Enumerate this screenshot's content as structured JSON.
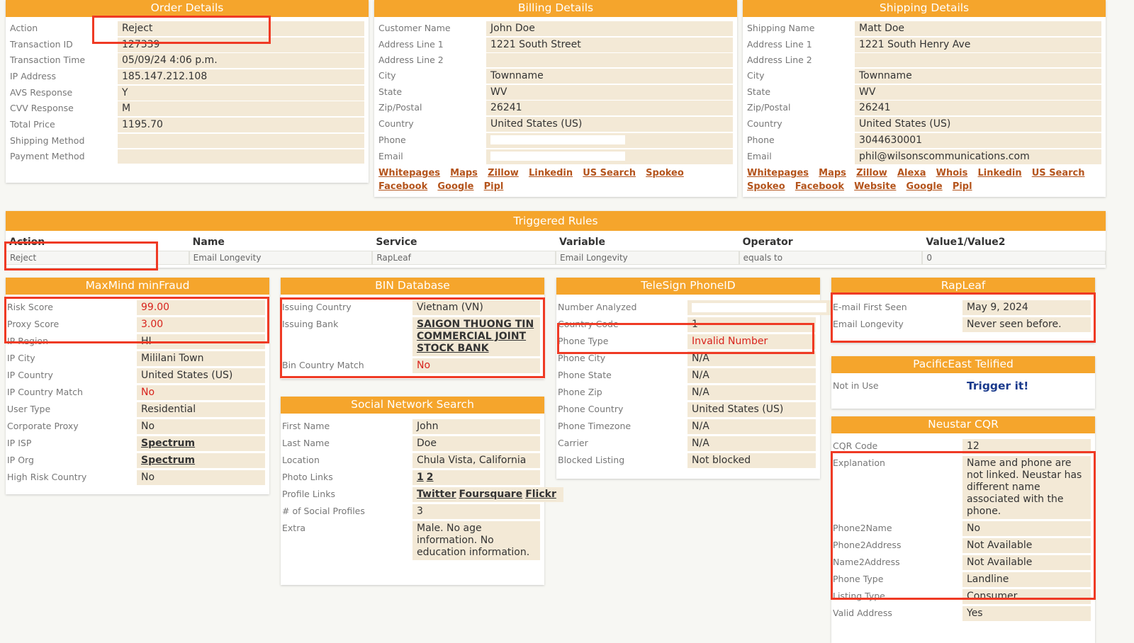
{
  "colors": {
    "header": "#f5a52c",
    "value_bg": "#f3e9d6",
    "alert": "#d8231c",
    "link": "#b4541c",
    "highlight": "#ef3a24"
  },
  "panels": {
    "order": {
      "title": "Order Details",
      "rows": [
        {
          "label": "Action",
          "value": "Reject"
        },
        {
          "label": "Transaction ID",
          "value": "127339"
        },
        {
          "label": "Transaction Time",
          "value": "05/09/24 4:06 p.m."
        },
        {
          "label": "IP Address",
          "value": "185.147.212.108"
        },
        {
          "label": "AVS Response",
          "value": "Y"
        },
        {
          "label": "CVV Response",
          "value": "M"
        },
        {
          "label": "Total Price",
          "value": "1195.70"
        },
        {
          "label": "Shipping Method",
          "value": ""
        },
        {
          "label": "Payment Method",
          "value": ""
        }
      ]
    },
    "billing": {
      "title": "Billing Details",
      "rows": [
        {
          "label": "Customer Name",
          "value": "John Doe"
        },
        {
          "label": "Address Line 1",
          "value": "1221 South Street"
        },
        {
          "label": "Address Line 2",
          "value": ""
        },
        {
          "label": "City",
          "value": "Townname"
        },
        {
          "label": "State",
          "value": "WV"
        },
        {
          "label": "Zip/Postal",
          "value": "26241"
        },
        {
          "label": "Country",
          "value": "United States (US)"
        },
        {
          "label": "Phone",
          "value": "",
          "style": "redacted"
        },
        {
          "label": "Email",
          "value": "",
          "style": "redacted"
        }
      ],
      "links": [
        "Whitepages",
        "Maps",
        "Zillow",
        "Linkedin",
        "US Search",
        "Spokeo",
        "Facebook",
        "Google",
        "Pipl"
      ]
    },
    "shipping": {
      "title": "Shipping Details",
      "rows": [
        {
          "label": "Shipping Name",
          "value": "Matt Doe"
        },
        {
          "label": "Address Line 1",
          "value": "1221 South Henry Ave"
        },
        {
          "label": "Address Line 2",
          "value": ""
        },
        {
          "label": "City",
          "value": "Townname"
        },
        {
          "label": "State",
          "value": "WV"
        },
        {
          "label": "Zip/Postal",
          "value": "26241"
        },
        {
          "label": "Country",
          "value": "United States (US)"
        },
        {
          "label": "Phone",
          "value": "3044630001"
        },
        {
          "label": "Email",
          "value": "phil@wilsonscommunications.com"
        }
      ],
      "links": [
        "Whitepages",
        "Maps",
        "Zillow",
        "Alexa",
        "Whois",
        "Linkedin",
        "US Search",
        "Spokeo",
        "Facebook",
        "Website",
        "Google",
        "Pipl"
      ]
    },
    "maxmind": {
      "title": "MaxMind minFraud",
      "rows": [
        {
          "label": "Risk Score",
          "value": "99.00",
          "style": "red"
        },
        {
          "label": "Proxy Score",
          "value": "3.00",
          "style": "red"
        },
        {
          "label": "IP Region",
          "value": "HI"
        },
        {
          "label": "IP City",
          "value": "Mililani Town"
        },
        {
          "label": "IP Country",
          "value": "United States (US)"
        },
        {
          "label": "IP Country Match",
          "value": "No",
          "style": "red"
        },
        {
          "label": "User Type",
          "value": "Residential"
        },
        {
          "label": "Corporate Proxy",
          "value": "No"
        },
        {
          "label": "IP ISP",
          "value": [
            "Spectrum"
          ],
          "style": "link"
        },
        {
          "label": "IP Org",
          "value": [
            "Spectrum"
          ],
          "style": "link"
        },
        {
          "label": "High Risk Country",
          "value": "No"
        }
      ]
    },
    "bin": {
      "title": "BIN Database",
      "rows": [
        {
          "label": "Issuing Country",
          "value": "Vietnam (VN)"
        },
        {
          "label": "Issuing Bank",
          "value": [
            "SAIGON THUONG TIN COMMERCIAL JOINT STOCK BANK"
          ],
          "style": "link"
        },
        {
          "label": "Bin Country Match",
          "value": "No",
          "style": "red"
        }
      ]
    },
    "social": {
      "title": "Social Network Search",
      "rows": [
        {
          "label": "First Name",
          "value": "John"
        },
        {
          "label": "Last Name",
          "value": "Doe"
        },
        {
          "label": "Location",
          "value": "Chula Vista, California"
        },
        {
          "label": "Photo Links",
          "value": [
            "1",
            "2"
          ],
          "style": "link"
        },
        {
          "label": "Profile Links",
          "value": [
            "Twitter",
            "Foursquare",
            "Flickr"
          ],
          "style": "link"
        },
        {
          "label": "# of Social Profiles",
          "value": "3"
        },
        {
          "label": "Extra",
          "value": "Male. No age information. No education information."
        }
      ]
    },
    "telesign": {
      "title": "TeleSign PhoneID",
      "rows": [
        {
          "label": "Number Analyzed",
          "value": "",
          "style": "redacted"
        },
        {
          "label": "Country Code",
          "value": "1"
        },
        {
          "label": "Phone Type",
          "value": "Invalid Number",
          "style": "red"
        },
        {
          "label": "Phone City",
          "value": "N/A"
        },
        {
          "label": "Phone State",
          "value": "N/A"
        },
        {
          "label": "Phone Zip",
          "value": "N/A"
        },
        {
          "label": "Phone Country",
          "value": "United States (US)"
        },
        {
          "label": "Phone Timezone",
          "value": "N/A"
        },
        {
          "label": "Carrier",
          "value": "N/A"
        },
        {
          "label": "Blocked Listing",
          "value": "Not blocked"
        }
      ]
    },
    "rapleaf": {
      "title": "RapLeaf",
      "rows": [
        {
          "label": "E-mail First Seen",
          "value": "May 9, 2024"
        },
        {
          "label": "Email Longevity",
          "value": "Never seen before."
        }
      ]
    },
    "pacific": {
      "title": "PacificEast Telified",
      "rows": [
        {
          "label": "Not in Use",
          "value": "Trigger it!",
          "style": "trigger"
        }
      ]
    },
    "neustar": {
      "title": "Neustar CQR",
      "rows": [
        {
          "label": "CQR Code",
          "value": "12"
        },
        {
          "label": "Explanation",
          "value": "Name and phone are not linked. Neustar has different name associated with the phone."
        },
        {
          "label": "Phone2Name",
          "value": "No"
        },
        {
          "label": "Phone2Address",
          "value": "Not Available"
        },
        {
          "label": "Name2Address",
          "value": "Not Available"
        },
        {
          "label": "Phone Type",
          "value": "Landline"
        },
        {
          "label": "Listing Type",
          "value": "Consumer"
        },
        {
          "label": "Valid Address",
          "value": "Yes"
        }
      ]
    }
  },
  "rules": {
    "title": "Triggered Rules",
    "headers": [
      "Action",
      "Name",
      "Service",
      "Variable",
      "Operator",
      "Value1/Value2"
    ],
    "rows": [
      [
        "Reject",
        "Email Longevity",
        "RapLeaf",
        "Email Longevity",
        "equals to",
        "0"
      ]
    ]
  }
}
